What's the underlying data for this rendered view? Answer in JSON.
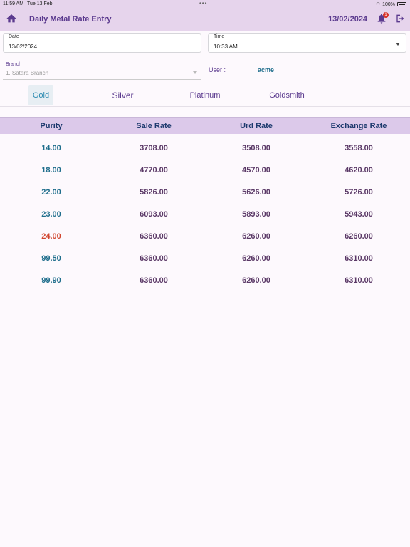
{
  "status_bar": {
    "time": "11:59 AM",
    "date": "Tue 13 Feb",
    "battery": "100%"
  },
  "app_bar": {
    "title": "Daily Metal Rate Entry",
    "date": "13/02/2024",
    "notification_count": "1"
  },
  "form": {
    "date_label": "Date",
    "date_value": "13/02/2024",
    "time_label": "Time",
    "time_value": "10:33 AM",
    "branch_label": "Branch",
    "branch_value": "1. Satara Branch",
    "user_label": "User :",
    "user_value": "acme"
  },
  "tabs": [
    {
      "label": "Gold",
      "active": true
    },
    {
      "label": "Silver",
      "active": false
    },
    {
      "label": "Platinum",
      "active": false
    },
    {
      "label": "Goldsmith",
      "active": false
    }
  ],
  "table": {
    "headers": [
      "Purity",
      "Sale Rate",
      "Urd Rate",
      "Exchange Rate"
    ],
    "rows": [
      {
        "purity": "14.00",
        "sale": "3708.00",
        "urd": "3508.00",
        "exchange": "3558.00",
        "highlight": false
      },
      {
        "purity": "18.00",
        "sale": "4770.00",
        "urd": "4570.00",
        "exchange": "4620.00",
        "highlight": false
      },
      {
        "purity": "22.00",
        "sale": "5826.00",
        "urd": "5626.00",
        "exchange": "5726.00",
        "highlight": false
      },
      {
        "purity": "23.00",
        "sale": "6093.00",
        "urd": "5893.00",
        "exchange": "5943.00",
        "highlight": false
      },
      {
        "purity": "24.00",
        "sale": "6360.00",
        "urd": "6260.00",
        "exchange": "6260.00",
        "highlight": true
      },
      {
        "purity": "99.50",
        "sale": "6360.00",
        "urd": "6260.00",
        "exchange": "6310.00",
        "highlight": false
      },
      {
        "purity": "99.90",
        "sale": "6360.00",
        "urd": "6260.00",
        "exchange": "6310.00",
        "highlight": false
      }
    ]
  },
  "colors": {
    "app_bar_bg": "#e6d4ec",
    "accent": "#5b3a8e",
    "purity_text": "#1f6e8c",
    "highlight_purity": "#d1462f",
    "table_header_bg": "#dcc9ea"
  }
}
